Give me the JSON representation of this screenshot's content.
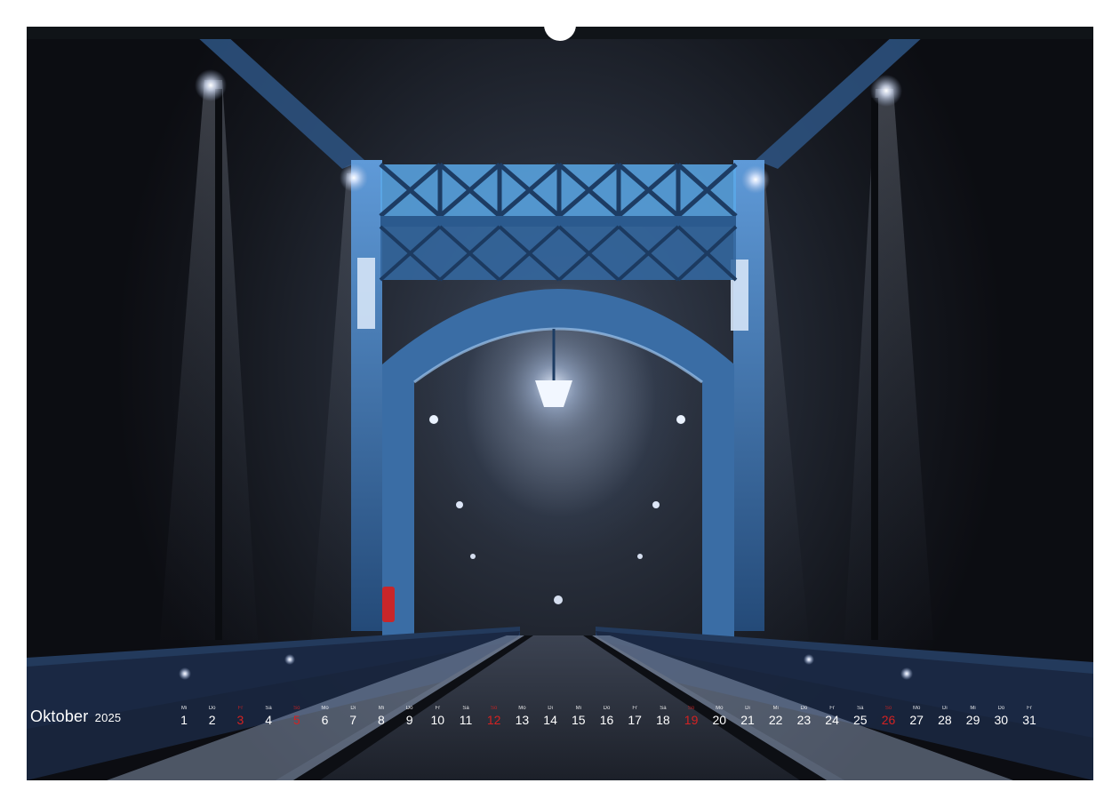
{
  "calendar": {
    "month": "Oktober",
    "year": "2025",
    "weekday_color": "#ffffff",
    "holiday_color": "#d42222",
    "days": [
      {
        "wd": "Mi",
        "num": "1",
        "red": false
      },
      {
        "wd": "Do",
        "num": "2",
        "red": false
      },
      {
        "wd": "Fr",
        "num": "3",
        "red": true
      },
      {
        "wd": "Sa",
        "num": "4",
        "red": false
      },
      {
        "wd": "So",
        "num": "5",
        "red": true
      },
      {
        "wd": "Mo",
        "num": "6",
        "red": false
      },
      {
        "wd": "Di",
        "num": "7",
        "red": false
      },
      {
        "wd": "Mi",
        "num": "8",
        "red": false
      },
      {
        "wd": "Do",
        "num": "9",
        "red": false
      },
      {
        "wd": "Fr",
        "num": "10",
        "red": false
      },
      {
        "wd": "Sa",
        "num": "11",
        "red": false
      },
      {
        "wd": "So",
        "num": "12",
        "red": true
      },
      {
        "wd": "Mo",
        "num": "13",
        "red": false
      },
      {
        "wd": "Di",
        "num": "14",
        "red": false
      },
      {
        "wd": "Mi",
        "num": "15",
        "red": false
      },
      {
        "wd": "Do",
        "num": "16",
        "red": false
      },
      {
        "wd": "Fr",
        "num": "17",
        "red": false
      },
      {
        "wd": "Sa",
        "num": "18",
        "red": false
      },
      {
        "wd": "So",
        "num": "19",
        "red": true
      },
      {
        "wd": "Mo",
        "num": "20",
        "red": false
      },
      {
        "wd": "Di",
        "num": "21",
        "red": false
      },
      {
        "wd": "Mi",
        "num": "22",
        "red": false
      },
      {
        "wd": "Do",
        "num": "23",
        "red": false
      },
      {
        "wd": "Fr",
        "num": "24",
        "red": false
      },
      {
        "wd": "Sa",
        "num": "25",
        "red": false
      },
      {
        "wd": "So",
        "num": "26",
        "red": true
      },
      {
        "wd": "Mo",
        "num": "27",
        "red": false
      },
      {
        "wd": "Di",
        "num": "28",
        "red": false
      },
      {
        "wd": "Mi",
        "num": "29",
        "red": false
      },
      {
        "wd": "Do",
        "num": "30",
        "red": false
      },
      {
        "wd": "Fr",
        "num": "31",
        "red": false
      }
    ]
  },
  "photo": {
    "subject": "bridge-at-night-in-fog",
    "steel_color": "#3d6fa8",
    "glow_color": "#e8f2ff"
  }
}
